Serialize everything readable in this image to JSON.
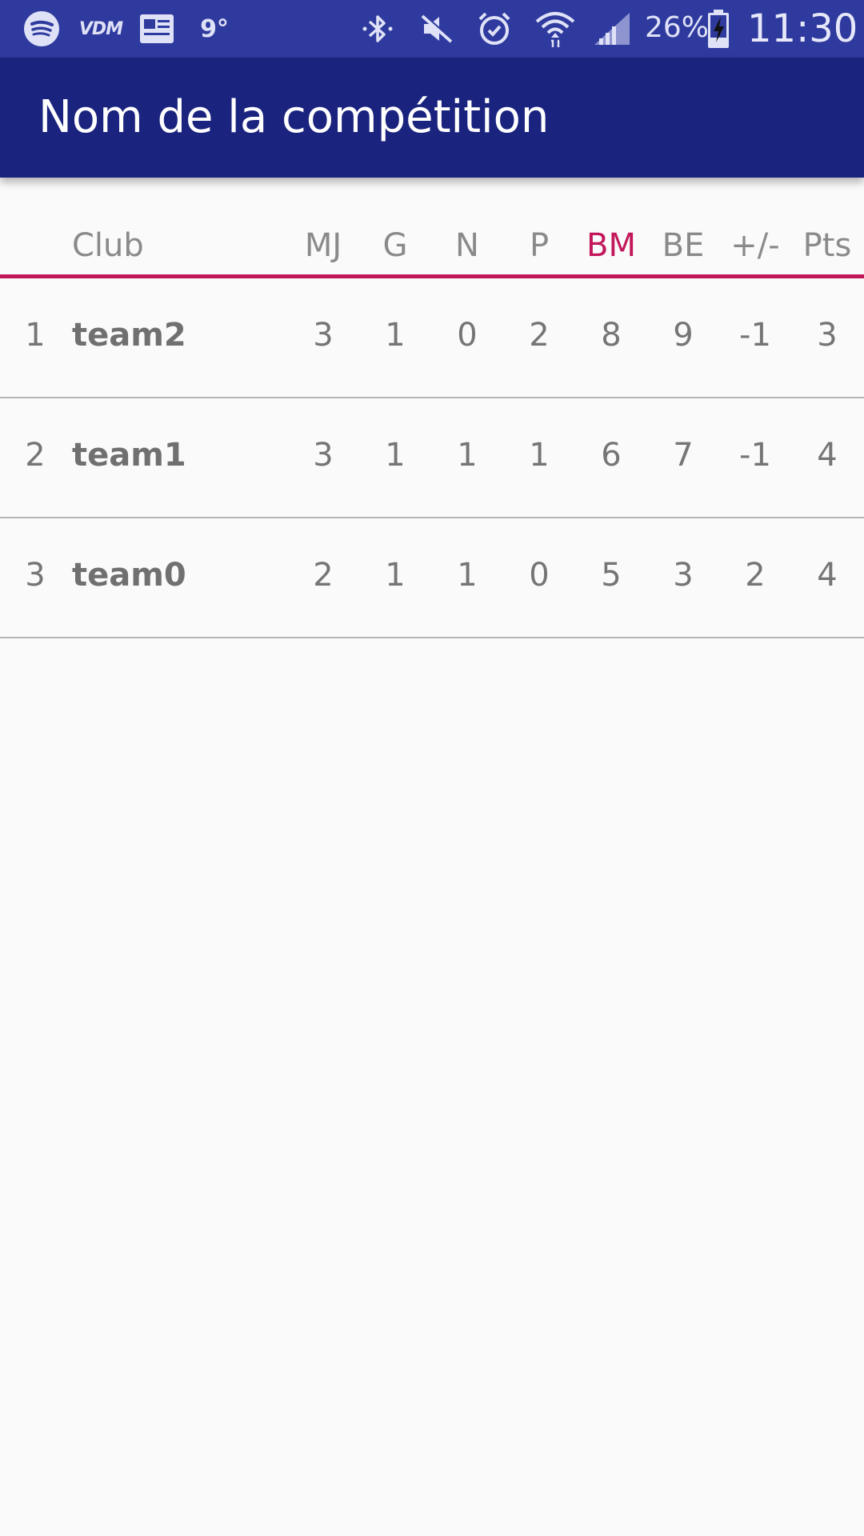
{
  "status_bar": {
    "icons": [
      "spotify-icon",
      "vdm-icon",
      "news-icon",
      "weather-icon",
      "bluetooth-icon",
      "mute-icon",
      "alarm-icon",
      "wifi-icon",
      "signal-icon",
      "battery-charging-icon"
    ],
    "vdm_label": "VDM",
    "temperature": "9°",
    "battery_percent": "26%",
    "time": "11:30"
  },
  "app_bar": {
    "title": "Nom de la compétition"
  },
  "table": {
    "accent_color": "#c2185b",
    "sorted_column": "BM",
    "headers": {
      "club": "Club",
      "mj": "MJ",
      "g": "G",
      "n": "N",
      "p": "P",
      "bm": "BM",
      "be": "BE",
      "diff": "+/-",
      "pts": "Pts"
    },
    "rows": [
      {
        "rank": "1",
        "club": "team2",
        "mj": "3",
        "g": "1",
        "n": "0",
        "p": "2",
        "bm": "8",
        "be": "9",
        "diff": "-1",
        "pts": "3"
      },
      {
        "rank": "2",
        "club": "team1",
        "mj": "3",
        "g": "1",
        "n": "1",
        "p": "1",
        "bm": "6",
        "be": "7",
        "diff": "-1",
        "pts": "4"
      },
      {
        "rank": "3",
        "club": "team0",
        "mj": "2",
        "g": "1",
        "n": "1",
        "p": "0",
        "bm": "5",
        "be": "3",
        "diff": "2",
        "pts": "4"
      }
    ]
  },
  "colors": {
    "status_bar": "#2f3a9e",
    "app_bar": "#1a237e",
    "background": "#fafafa"
  }
}
